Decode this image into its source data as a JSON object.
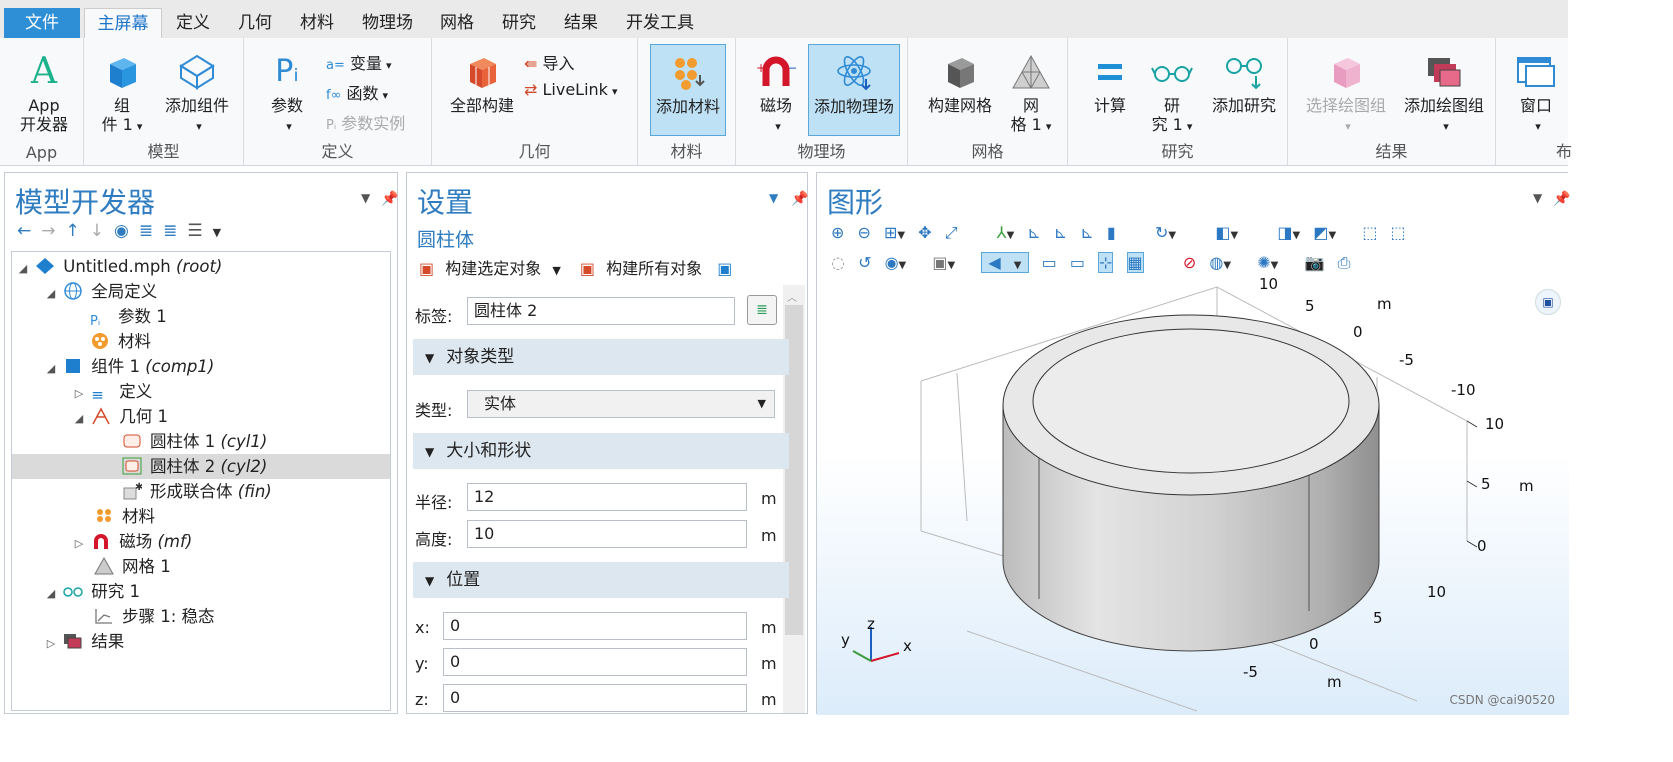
{
  "tabs": [
    "文件",
    "主屏幕",
    "定义",
    "几何",
    "材料",
    "物理场",
    "网格",
    "研究",
    "结果",
    "开发工具"
  ],
  "ribbon": {
    "app": {
      "label_line1": "App",
      "label_line2": "开发器",
      "group": "App"
    },
    "model": {
      "component": "组\n件 1",
      "add_component": "添加组件",
      "group": "模型"
    },
    "definitions": {
      "params": "参数",
      "variables": "变量",
      "functions": "函数",
      "param_case": "参数实例",
      "group": "定义"
    },
    "geometry": {
      "build_all": "全部构建",
      "import": "导入",
      "livelink": "LiveLink",
      "group": "几何"
    },
    "materials": {
      "add_material": "添加材料",
      "group": "材料"
    },
    "physics": {
      "magnetic": "磁场",
      "add_physics": "添加物理场",
      "group": "物理场"
    },
    "mesh": {
      "build_mesh": "构建网格",
      "mesh1": "网\n格 1",
      "group": "网格"
    },
    "study": {
      "compute": "计算",
      "study1": "研\n究 1",
      "add_study": "添加研究",
      "group": "研究"
    },
    "results": {
      "select_plot": "选择绘图组",
      "add_plot": "添加绘图组",
      "group": "结果"
    },
    "window": {
      "label": "窗口",
      "group": "布"
    }
  },
  "model_builder": {
    "title": "模型开发器",
    "tree": [
      {
        "label": "Untitled.mph",
        "tag": "(root)"
      },
      {
        "label": "全局定义",
        "tag": ""
      },
      {
        "label": "参数 1",
        "tag": ""
      },
      {
        "label": "材料",
        "tag": ""
      },
      {
        "label": "组件 1",
        "tag": "(comp1)"
      },
      {
        "label": "定义",
        "tag": ""
      },
      {
        "label": "几何 1",
        "tag": ""
      },
      {
        "label": "圆柱体 1",
        "tag": "(cyl1)"
      },
      {
        "label": "圆柱体 2",
        "tag": "(cyl2)"
      },
      {
        "label": "形成联合体",
        "tag": "(fin)"
      },
      {
        "label": "材料",
        "tag": ""
      },
      {
        "label": "磁场",
        "tag": "(mf)"
      },
      {
        "label": "网格 1",
        "tag": ""
      },
      {
        "label": "研究 1",
        "tag": ""
      },
      {
        "label": "步骤 1: 稳态",
        "tag": ""
      },
      {
        "label": "结果",
        "tag": ""
      }
    ]
  },
  "settings": {
    "title": "设置",
    "subtitle": "圆柱体",
    "build_selected": "构建选定对象",
    "build_all": "构建所有对象",
    "label_caption": "标签:",
    "label_value": "圆柱体 2",
    "sec_object_type": "对象类型",
    "type_caption": "类型:",
    "type_value": "实体",
    "sec_size": "大小和形状",
    "radius_caption": "半径:",
    "radius_value": "12",
    "height_caption": "高度:",
    "height_value": "10",
    "unit": "m",
    "sec_position": "位置",
    "x_caption": "x:",
    "x_value": "0",
    "y_caption": "y:",
    "y_value": "0",
    "z_caption": "z:",
    "z_value": "0"
  },
  "graphics": {
    "title": "图形",
    "axis_labels": {
      "top_10": "10",
      "top_5": "5",
      "top_m": "m",
      "top_0": "0",
      "top_m5": "-5",
      "top_m10": "-10",
      "r_10": "10",
      "r_5": "5",
      "r_m": "m",
      "r_0": "0",
      "b_10": "10",
      "b_5": "5",
      "b_0": "0",
      "b_m5": "-5",
      "b_m": "m"
    },
    "triad": {
      "x": "x",
      "y": "y",
      "z": "z"
    },
    "watermark": "CSDN @cai90520"
  },
  "colors": {
    "accent": "#2f7cc0",
    "file_tab": "#2e8fd6",
    "selected_btn": "#bfe1f6",
    "section_bg": "#dde7f0"
  }
}
